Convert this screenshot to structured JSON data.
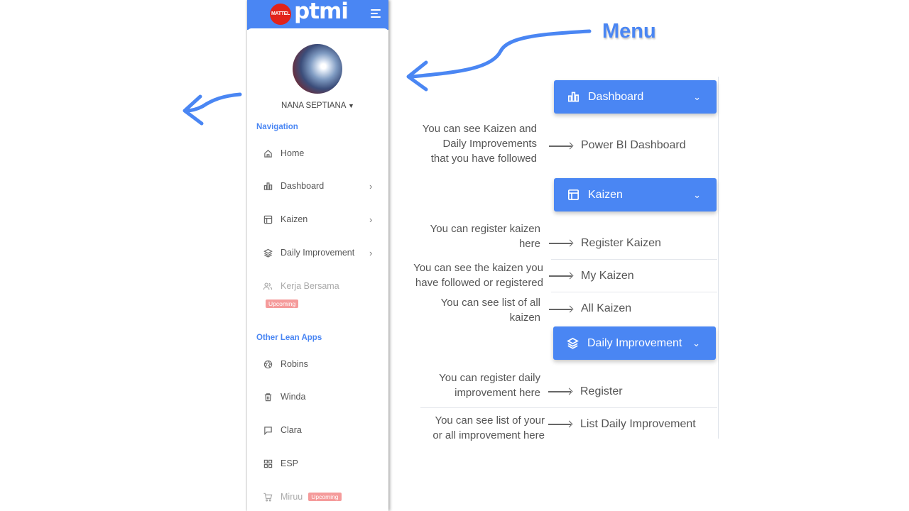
{
  "brand": {
    "badge": "MATTEL",
    "name": "ptmi"
  },
  "user": {
    "name": "NANA SEPTIANA"
  },
  "sidebar": {
    "navigation_title": "Navigation",
    "items": [
      {
        "label": "Home",
        "icon": "home-icon"
      },
      {
        "label": "Dashboard",
        "icon": "bar-chart-icon"
      },
      {
        "label": "Kaizen",
        "icon": "layout-icon"
      },
      {
        "label": "Daily Improvement",
        "icon": "layers-icon"
      },
      {
        "label": "Kerja Bersama",
        "icon": "users-icon",
        "badge": "Upcoming"
      }
    ],
    "other_title": "Other Lean Apps",
    "other_items": [
      {
        "label": "Robins",
        "icon": "aperture-icon"
      },
      {
        "label": "Winda",
        "icon": "trash-icon"
      },
      {
        "label": "Clara",
        "icon": "message-square-icon"
      },
      {
        "label": "ESP",
        "icon": "grid-icon"
      },
      {
        "label": "Miruu",
        "icon": "shopping-cart-icon",
        "badge": "Upcoming"
      }
    ]
  },
  "annotations": {
    "menu_title": "Menu",
    "dashboard": {
      "button": "Dashboard",
      "desc": [
        "You can see Kaizen and",
        "Daily Improvements",
        "that you have followed"
      ],
      "target": "Power BI Dashboard"
    },
    "kaizen": {
      "button": "Kaizen",
      "rows": [
        {
          "desc": [
            "You can register kaizen",
            "here"
          ],
          "target": "Register Kaizen"
        },
        {
          "desc": [
            "You can see the kaizen you",
            "have followed or registered"
          ],
          "target": "My Kaizen"
        },
        {
          "desc": [
            "You can see list of all",
            "kaizen"
          ],
          "target": "All Kaizen"
        }
      ]
    },
    "daily": {
      "button": "Daily Improvement",
      "rows": [
        {
          "desc": [
            "You can register daily",
            "improvement  here"
          ],
          "target": "Register"
        },
        {
          "desc": [
            "You can see list of your",
            "or all improvement  here"
          ],
          "target": "List Daily Improvement"
        }
      ]
    }
  },
  "colors": {
    "accent": "#4a86f3",
    "badge": "#f59b9b",
    "brand_red": "#e2231a"
  }
}
